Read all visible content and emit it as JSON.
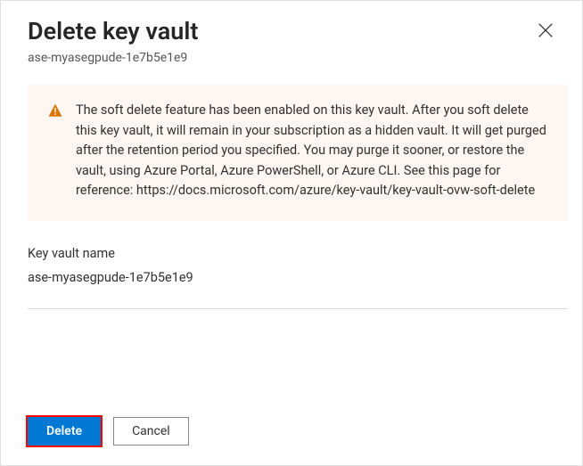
{
  "header": {
    "title": "Delete key vault",
    "subtitle": "ase-myasegpude-1e7b5e1e9"
  },
  "warning": {
    "text": "The soft delete feature has been enabled on this key vault. After you soft delete this key vault, it will remain in your subscription as a hidden vault. It will get purged after the retention period you specified. You may purge it sooner, or restore the vault, using Azure Portal, Azure PowerShell, or Azure CLI. See this page for reference: https://docs.microsoft.com/azure/key-vault/key-vault-ovw-soft-delete"
  },
  "fields": {
    "keyVaultName": {
      "label": "Key vault name",
      "value": "ase-myasegpude-1e7b5e1e9"
    }
  },
  "footer": {
    "deleteLabel": "Delete",
    "cancelLabel": "Cancel"
  }
}
